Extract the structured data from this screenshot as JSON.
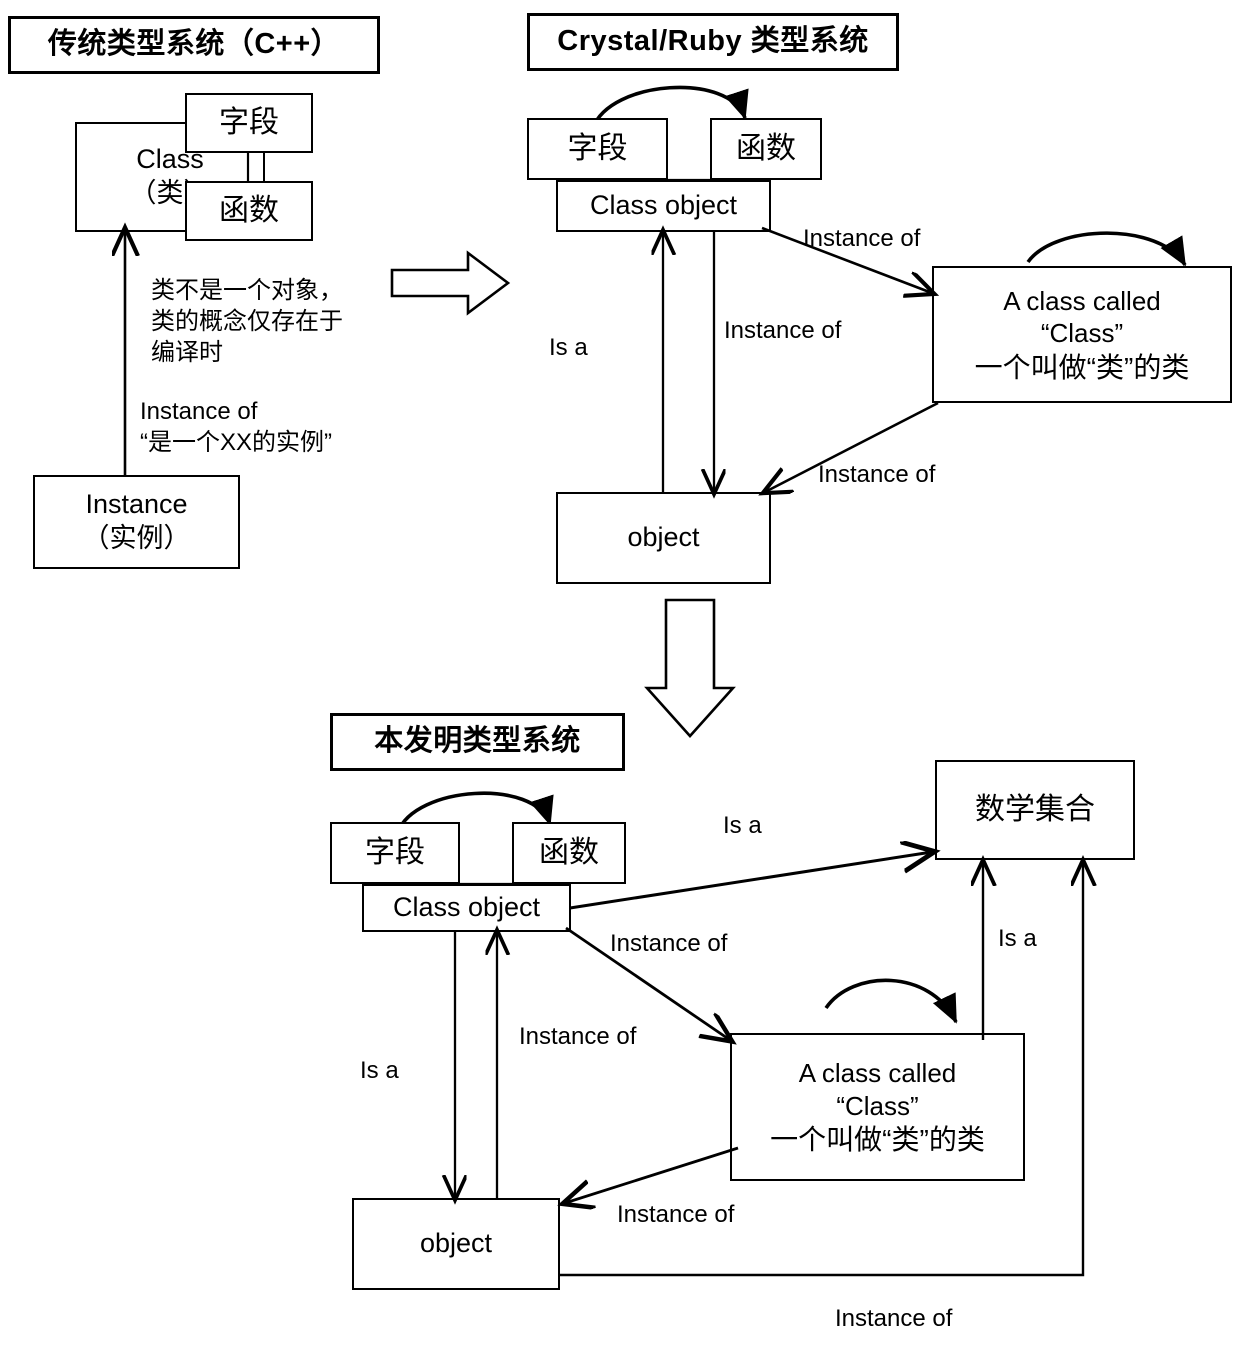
{
  "diagram": {
    "kind": "three-panel comparison of type systems",
    "panels": [
      {
        "id": "traditional",
        "title": "传统类型系统（C++）",
        "nodes": [
          {
            "id": "class",
            "label": "Class\n（类）"
          },
          {
            "id": "field",
            "label": "字段"
          },
          {
            "id": "function",
            "label": "函数"
          },
          {
            "id": "instance",
            "label": "Instance\n（实例）"
          }
        ],
        "notes": [
          "类不是一个对象，\n类的概念仅存在于\n编译时",
          "Instance of\n“是一个XX的实例”"
        ],
        "edges": [
          {
            "from": "instance",
            "to": "class",
            "label": ""
          }
        ]
      },
      {
        "id": "crystal_ruby",
        "title": "Crystal/Ruby 类型系统",
        "nodes": [
          {
            "id": "field",
            "label": "字段"
          },
          {
            "id": "function",
            "label": "函数"
          },
          {
            "id": "class_object",
            "label": "Class object"
          },
          {
            "id": "class_called_class",
            "label": "A class called\n“Class”\n一个叫做“类”的类"
          },
          {
            "id": "object",
            "label": "object"
          }
        ],
        "edges": [
          {
            "from": "class_object",
            "to": "class_called_class",
            "label": "Instance of"
          },
          {
            "from": "class_object",
            "to": "object",
            "label": "Instance of"
          },
          {
            "from": "object",
            "to": "class_object",
            "label": "Is a"
          },
          {
            "from": "class_called_class",
            "to": "object",
            "label": "Instance of"
          },
          {
            "from": "class_called_class",
            "to": "class_called_class",
            "label": ""
          },
          {
            "from": "field",
            "to": "function",
            "label": ""
          }
        ]
      },
      {
        "id": "invention",
        "title": "本发明类型系统",
        "nodes": [
          {
            "id": "field",
            "label": "字段"
          },
          {
            "id": "function",
            "label": "函数"
          },
          {
            "id": "class_object",
            "label": "Class object"
          },
          {
            "id": "math_set",
            "label": "数学集合"
          },
          {
            "id": "class_called_class",
            "label": "A class called\n“Class”\n一个叫做“类”的类"
          },
          {
            "id": "object",
            "label": "object"
          }
        ],
        "edges": [
          {
            "from": "class_object",
            "to": "math_set",
            "label": "Is a"
          },
          {
            "from": "class_object",
            "to": "class_called_class",
            "label": "Instance of"
          },
          {
            "from": "class_object",
            "to": "object",
            "label": "Is a"
          },
          {
            "from": "object",
            "to": "class_object",
            "label": "Instance of"
          },
          {
            "from": "class_called_class",
            "to": "math_set",
            "label": "Is a"
          },
          {
            "from": "class_called_class",
            "to": "object",
            "label": "Instance of"
          },
          {
            "from": "object",
            "to": "math_set",
            "label": "Instance of"
          },
          {
            "from": "class_called_class",
            "to": "class_called_class",
            "label": ""
          },
          {
            "from": "field",
            "to": "function",
            "label": ""
          }
        ]
      }
    ],
    "flow_arrows": [
      {
        "id": "traditional-to-crystal",
        "direction": "right"
      },
      {
        "id": "crystal-to-invention",
        "direction": "down"
      }
    ],
    "labels": {
      "instance_of": "Instance of",
      "is_a": "Is a",
      "class_object": "Class object",
      "object": "object",
      "math_set": "数学集合",
      "field": "字段",
      "function": "函数",
      "class_cn": "Class\n（类）",
      "instance_cn": "Instance\n（实例）",
      "class_called_class": "A class called\n“Class”\n一个叫做“类”的类",
      "note_compile_time": "类不是一个对象，\n类的概念仅存在于\n编译时",
      "note_instance_of": "Instance of\n“是一个XX的实例”",
      "title_traditional": "传统类型系统（C++）",
      "title_crystal": "Crystal/Ruby 类型系统",
      "title_invention": "本发明类型系统"
    },
    "colors": {
      "stroke": "#000000",
      "fill": "#ffffff",
      "text": "#000000"
    }
  }
}
